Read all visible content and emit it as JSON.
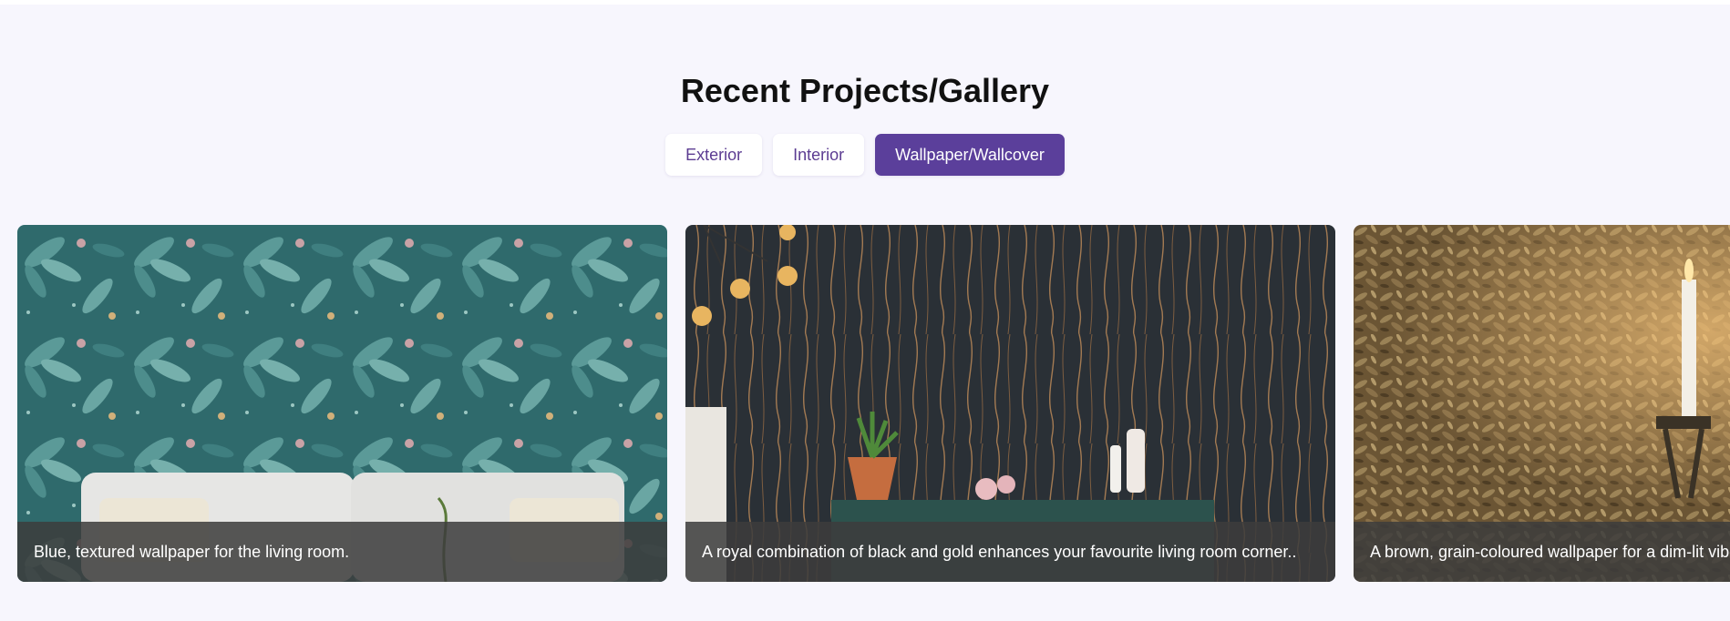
{
  "gallery": {
    "title": "Recent Projects/Gallery",
    "filters": [
      {
        "label": "Exterior",
        "active": false
      },
      {
        "label": "Interior",
        "active": false
      },
      {
        "label": "Wallpaper/Wallcover",
        "active": true
      }
    ],
    "cards": [
      {
        "caption": "Blue, textured wallpaper for the living room."
      },
      {
        "caption": "A royal combination of black and gold enhances your favourite living room corner.."
      },
      {
        "caption": "A brown, grain-coloured wallpaper for a dim-lit vibe."
      }
    ]
  },
  "colors": {
    "background": "#f7f6fd",
    "accent": "#5b3f9b",
    "filter_text": "#5c3c92",
    "caption_bar": "#3c3c3c"
  }
}
